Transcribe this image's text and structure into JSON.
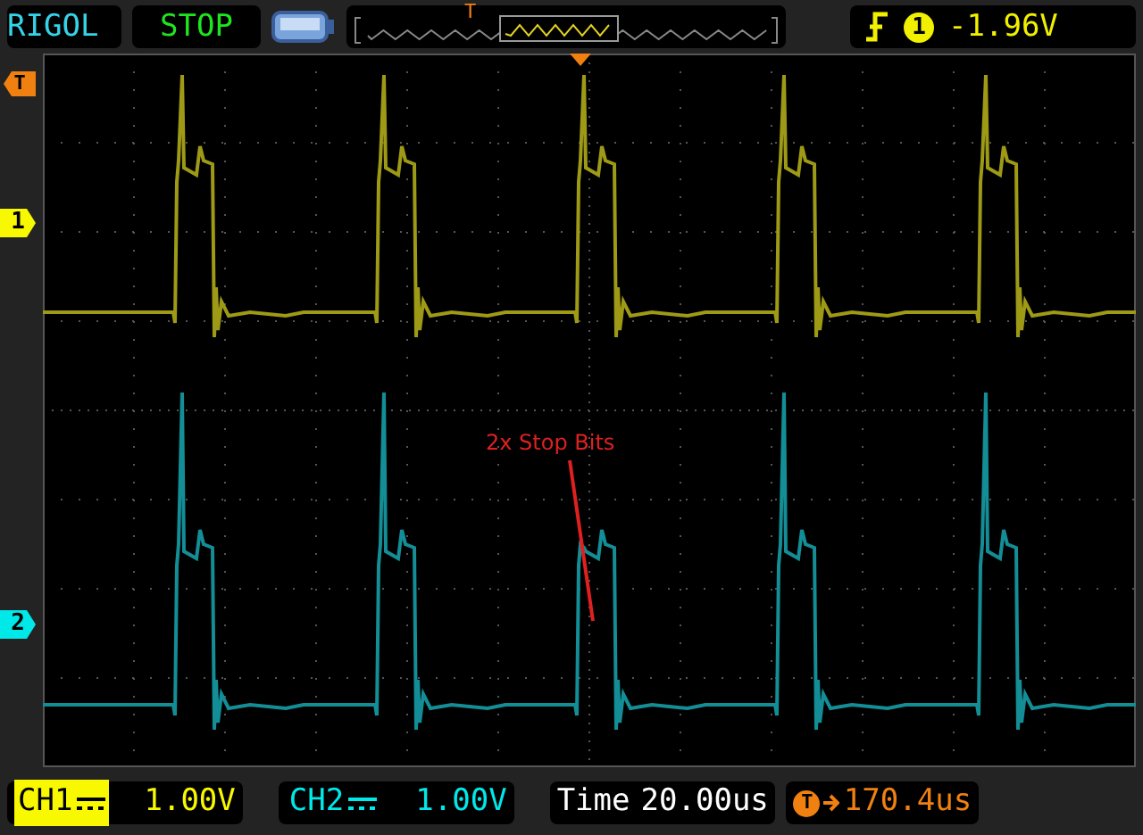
{
  "header": {
    "brand": "RIGOL",
    "run_state": "STOP",
    "overview_trigger": "T",
    "trigger": {
      "source": "1",
      "level": "-1.96V"
    }
  },
  "markers": {
    "trigger_level": "T",
    "channels": [
      {
        "label": "1",
        "color": "#f8f800"
      },
      {
        "label": "2",
        "color": "#00e8e8"
      }
    ]
  },
  "annotation": {
    "text": "2x Stop Bits"
  },
  "footer": {
    "channels": [
      {
        "label": "CH1",
        "scale": "1.00V",
        "selected": true,
        "color": "#f8f800"
      },
      {
        "label": "CH2",
        "scale": "1.00V",
        "selected": false,
        "color": "#00e8e8"
      }
    ],
    "time": {
      "label": "Time",
      "value": "20.00us"
    },
    "trigger_offset": {
      "symbol": "T",
      "value": "170.4us"
    }
  }
}
